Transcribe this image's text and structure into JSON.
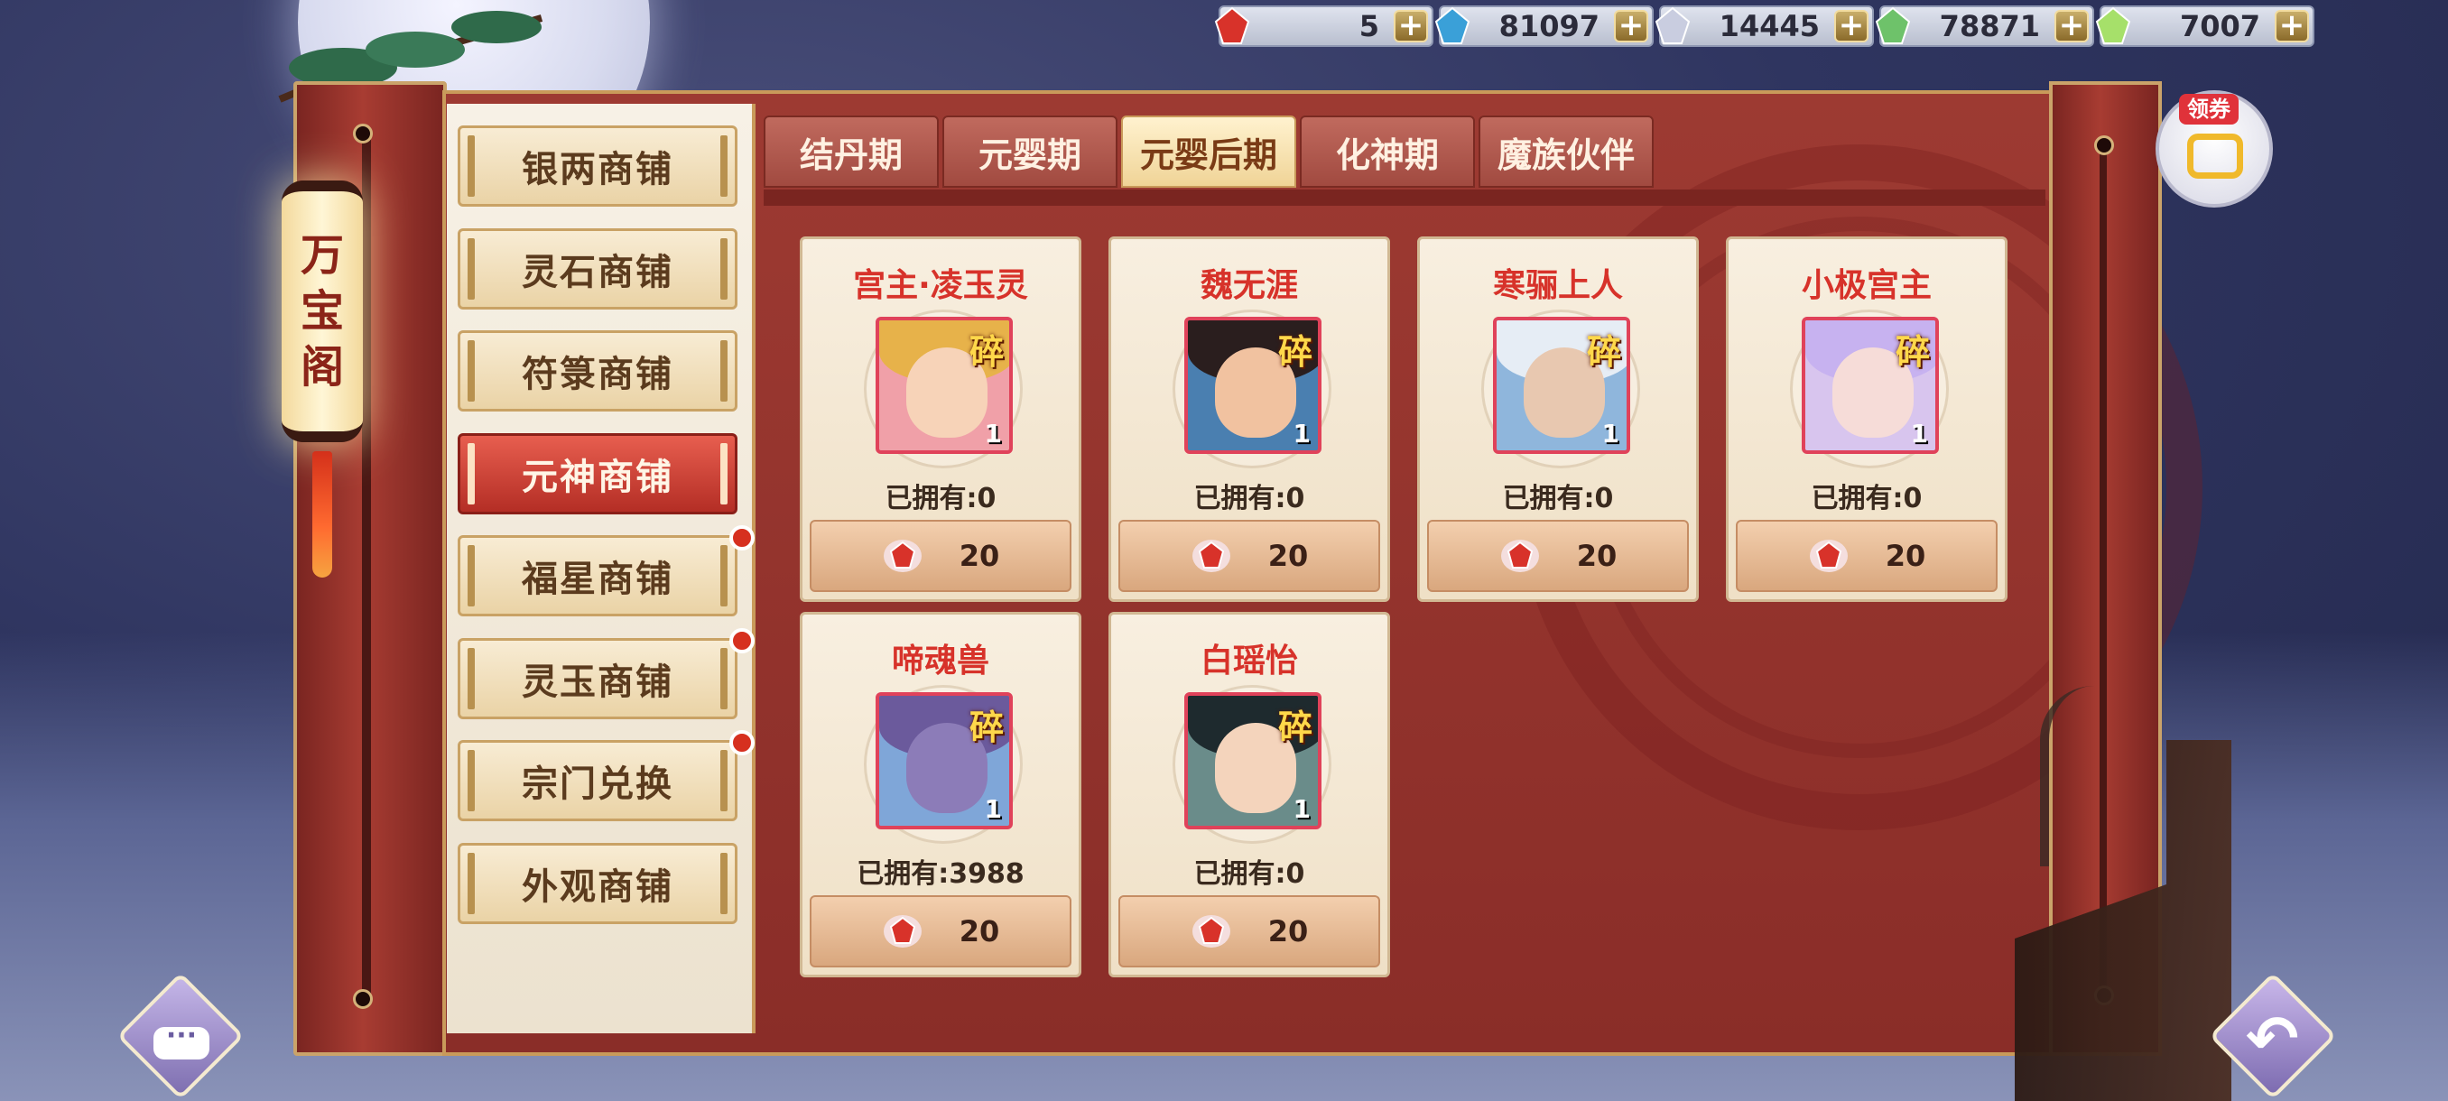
{
  "currencies": [
    {
      "icon": "red-gem-icon",
      "value": "5",
      "color": "#d8322a"
    },
    {
      "icon": "blue-crystal-icon",
      "value": "81097",
      "color": "#3aa0d8"
    },
    {
      "icon": "silver-cloud-icon",
      "value": "14445",
      "color": "#c9cde0"
    },
    {
      "icon": "jade-crystal-icon",
      "value": "78871",
      "color": "#6ec26a"
    },
    {
      "icon": "rainbow-crystal-icon",
      "value": "7007",
      "color": "#a6e06a"
    }
  ],
  "currency_plus_label": "+",
  "lantern_title": [
    "万",
    "宝",
    "阁"
  ],
  "shops": [
    {
      "label": "银两商铺",
      "active": false,
      "alert": false
    },
    {
      "label": "灵石商铺",
      "active": false,
      "alert": false
    },
    {
      "label": "符箓商铺",
      "active": false,
      "alert": false
    },
    {
      "label": "元神商铺",
      "active": true,
      "alert": false
    },
    {
      "label": "福星商铺",
      "active": false,
      "alert": true
    },
    {
      "label": "灵玉商铺",
      "active": false,
      "alert": true
    },
    {
      "label": "宗门兑换",
      "active": false,
      "alert": true
    },
    {
      "label": "外观商铺",
      "active": false,
      "alert": false
    }
  ],
  "tabs": [
    {
      "label": "结丹期",
      "active": false
    },
    {
      "label": "元婴期",
      "active": false
    },
    {
      "label": "元婴后期",
      "active": true
    },
    {
      "label": "化神期",
      "active": false
    },
    {
      "label": "魔族伙伴",
      "active": false
    }
  ],
  "items": [
    {
      "name": "宫主·凌玉灵",
      "frag": "碎",
      "qty": "1",
      "owned": "已拥有:0",
      "price": "20",
      "palette": {
        "bg": "#f0a0a8",
        "hair": "#e7b24a",
        "face": "#f7d3b8"
      }
    },
    {
      "name": "魏无涯",
      "frag": "碎",
      "qty": "1",
      "owned": "已拥有:0",
      "price": "20",
      "palette": {
        "bg": "#4a7fb0",
        "hair": "#2a1e1e",
        "face": "#f1c2a0"
      }
    },
    {
      "name": "寒骊上人",
      "frag": "碎",
      "qty": "1",
      "owned": "已拥有:0",
      "price": "20",
      "palette": {
        "bg": "#8fb6dc",
        "hair": "#e6edf5",
        "face": "#e8c8b0"
      }
    },
    {
      "name": "小极宫主",
      "frag": "碎",
      "qty": "1",
      "owned": "已拥有:0",
      "price": "20",
      "palette": {
        "bg": "#d8c5ee",
        "hair": "#c7b2f0",
        "face": "#f6dcd8"
      }
    },
    {
      "name": "啼魂兽",
      "frag": "碎",
      "qty": "1",
      "owned": "已拥有:3988",
      "price": "20",
      "palette": {
        "bg": "#7fa6d8",
        "hair": "#6b5a9c",
        "face": "#8c7cb8"
      }
    },
    {
      "name": "白瑶怡",
      "frag": "碎",
      "qty": "1",
      "owned": "已拥有:0",
      "price": "20",
      "palette": {
        "bg": "#6a8c8a",
        "hair": "#1e2a2e",
        "face": "#f4d4bc"
      }
    }
  ],
  "price_icon": "red-gem-icon",
  "coupon": {
    "label": "领券"
  },
  "chat_button": {
    "icon": "chat-bubble-icon",
    "label": "···"
  },
  "back_button": {
    "icon": "back-arrow-icon",
    "label": "↶"
  }
}
